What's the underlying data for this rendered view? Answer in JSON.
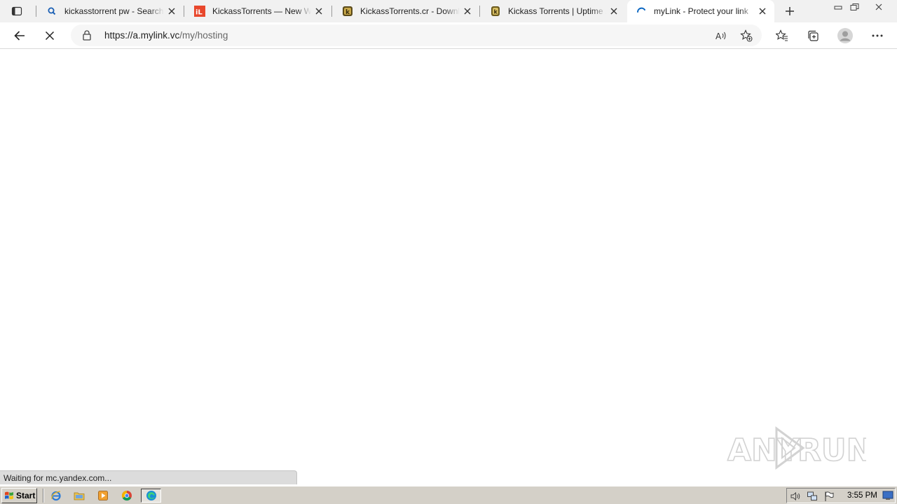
{
  "browser": {
    "tabs": [
      {
        "title": "kickasstorrent pw - Search",
        "favicon": "search-icon",
        "active": false
      },
      {
        "title": "KickassTorrents — New W",
        "favicon": "il-logo-icon",
        "active": false
      },
      {
        "title": "KickassTorrents.cr - Downl",
        "favicon": "kickass-logo-icon",
        "active": false
      },
      {
        "title": "Kickass Torrents | Uptime /",
        "favicon": "kickass-logo-icon",
        "active": false
      },
      {
        "title": "myLink - Protect your link",
        "favicon": "loading-spinner-icon",
        "active": true
      }
    ],
    "address": {
      "host": "https://a.mylink.vc",
      "path": "/my/hosting"
    }
  },
  "status": {
    "text": "Waiting for mc.yandex.com..."
  },
  "watermark": {
    "text_left": "ANY",
    "text_right": "RUN"
  },
  "taskbar": {
    "start_label": "Start",
    "clock": "3:55 PM"
  },
  "colors": {
    "accent": "#0a66c2",
    "tabstrip_bg": "#f1f1f1",
    "taskbar_bg": "#d4d0c8",
    "il_red": "#e8472c"
  }
}
